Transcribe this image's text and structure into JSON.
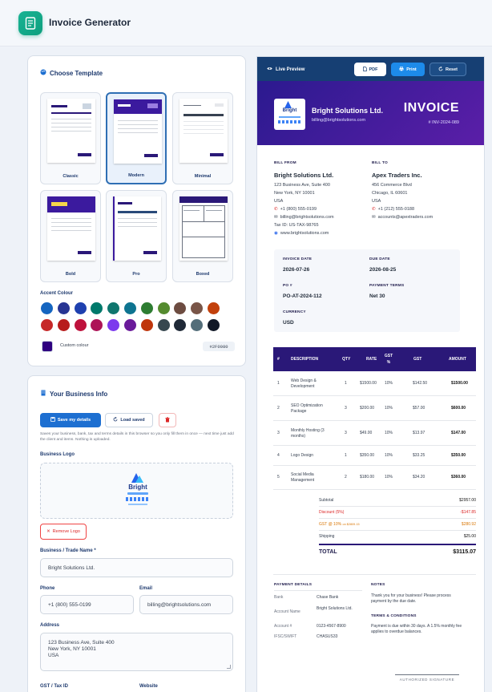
{
  "app": {
    "title": "Invoice Generator"
  },
  "template_panel": {
    "title": "Choose Template",
    "templates": [
      {
        "label": "Classic",
        "selected": false
      },
      {
        "label": "Modern",
        "selected": true
      },
      {
        "label": "Minimal",
        "selected": false
      },
      {
        "label": "Bold",
        "selected": false
      },
      {
        "label": "Pro",
        "selected": false
      },
      {
        "label": "Boxed",
        "selected": false
      }
    ],
    "accent_label": "Accent Colour",
    "swatches": [
      "#1565c0",
      "#283593",
      "#1e40af",
      "#00796b",
      "#0f766e",
      "#0e7490",
      "#2e7d32",
      "#558b2f",
      "#6d4c41",
      "#795548",
      "#c2410c",
      "#c62828",
      "#b71c1c",
      "#be123c",
      "#ad1457",
      "#7c3aed",
      "#6a1b9a",
      "#bf360c",
      "#37474f",
      "#1f2937",
      "#546e7a",
      "#111827"
    ],
    "custom_label": "Custom colour",
    "custom_color": "#2F0080",
    "custom_value": "#2F0080"
  },
  "business": {
    "title": "Your Business Info",
    "save_label": "Save my details",
    "load_label": "Load saved",
    "hint": "Saves your business, bank, tax and terms details in this browser so you only fill them in once — next time just add the client and items. Nothing is uploaded.",
    "logo_label": "Business Logo",
    "logo_text": "Bright",
    "remove_logo_label": "Remove Logo",
    "name_label": "Business / Trade Name *",
    "name_value": "Bright Solutions Ltd.",
    "phone_label": "Phone",
    "phone_value": "+1 (800) 555-0199",
    "email_label": "Email",
    "email_value": "billing@brightsolutions.com",
    "address_label": "Address",
    "address_lines": [
      "123 Business Ave, Suite 400",
      "New York, NY 10001",
      "USA"
    ],
    "gst_label": "GST / Tax ID",
    "website_label": "Website"
  },
  "preview": {
    "title": "Live Preview",
    "pdf_label": "PDF",
    "print_label": "Print",
    "reset_label": "Reset",
    "company": "Bright Solutions Ltd.",
    "company_email": "billing@brightsolutions.com",
    "doc_title": "INVOICE",
    "invoice_number": "# INV-2024-089",
    "bill_from_label": "BILL FROM",
    "bill_from": {
      "name": "Bright Solutions Ltd.",
      "lines": [
        "123 Business Ave, Suite 400",
        "New York, NY 10001",
        "USA"
      ],
      "phone": "+1 (800) 555-0199",
      "email": "billing@brightsolutions.com",
      "tax": "Tax ID: US-TAX-98765",
      "website": "www.brightsolutions.com"
    },
    "bill_to_label": "BILL TO",
    "bill_to": {
      "name": "Apex Traders Inc.",
      "lines": [
        "456 Commerce Blvd",
        "Chicago, IL 60601",
        "USA"
      ],
      "phone": "+1 (212) 555-0188",
      "email": "accounts@apextraders.com"
    },
    "meta": {
      "invoice_date_label": "INVOICE DATE",
      "invoice_date": "2026-07-26",
      "due_date_label": "DUE DATE",
      "due_date": "2026-08-25",
      "po_label": "PO #",
      "po": "PO-AT-2024-112",
      "terms_label": "PAYMENT TERMS",
      "terms": "Net 30",
      "currency_label": "CURRENCY",
      "currency": "USD"
    },
    "table_headers": {
      "num": "#",
      "desc": "DESCRIPTION",
      "qty": "QTY",
      "rate": "RATE",
      "gst_pct": "GST %",
      "gst": "GST",
      "amount": "AMOUNT"
    },
    "items": [
      {
        "n": "1",
        "desc": "Web Design & Development",
        "qty": "1",
        "rate": "$1500.00",
        "pct": "10%",
        "gst": "$142.50",
        "amount": "$1500.00"
      },
      {
        "n": "2",
        "desc": "SEO Optimization Package",
        "qty": "3",
        "rate": "$200.00",
        "pct": "10%",
        "gst": "$57.00",
        "amount": "$600.00"
      },
      {
        "n": "3",
        "desc": "Monthly Hosting (3 months)",
        "qty": "3",
        "rate": "$49.00",
        "pct": "10%",
        "gst": "$13.97",
        "amount": "$147.00"
      },
      {
        "n": "4",
        "desc": "Logo Design",
        "qty": "1",
        "rate": "$350.00",
        "pct": "10%",
        "gst": "$33.25",
        "amount": "$350.00"
      },
      {
        "n": "5",
        "desc": "Social Media Management",
        "qty": "2",
        "rate": "$180.00",
        "pct": "10%",
        "gst": "$34.20",
        "amount": "$360.00"
      }
    ],
    "totals": {
      "subtotal_label": "Subtotal",
      "subtotal": "$2957.00",
      "discount_label": "Discount (5%)",
      "discount": "-$147.85",
      "gst_label": "GST @ 10%",
      "gst_note": "on $2809.15",
      "gst": "$280.92",
      "shipping_label": "Shipping",
      "shipping": "$25.00",
      "total_label": "TOTAL",
      "total": "$3115.07"
    },
    "payment": {
      "title": "PAYMENT DETAILS",
      "bank_label": "Bank",
      "bank": "Chase Bank",
      "account_name_label": "Account Name",
      "account_name": "Bright Solutions Ltd.",
      "account_no_label": "Account #",
      "account_no": "0123-4567-8900",
      "ifsc_label": "IFSC/SWIFT",
      "ifsc": "CHASUS33"
    },
    "notes": {
      "title": "NOTES",
      "text": "Thank you for your business! Please process payment by the due date.",
      "terms_title": "TERMS & CONDITIONS",
      "terms_text": "Payment is due within 30 days. A 1.5% monthly fee applies to overdue balances."
    },
    "signature_label": "AUTHORIZED SIGNATURE"
  }
}
